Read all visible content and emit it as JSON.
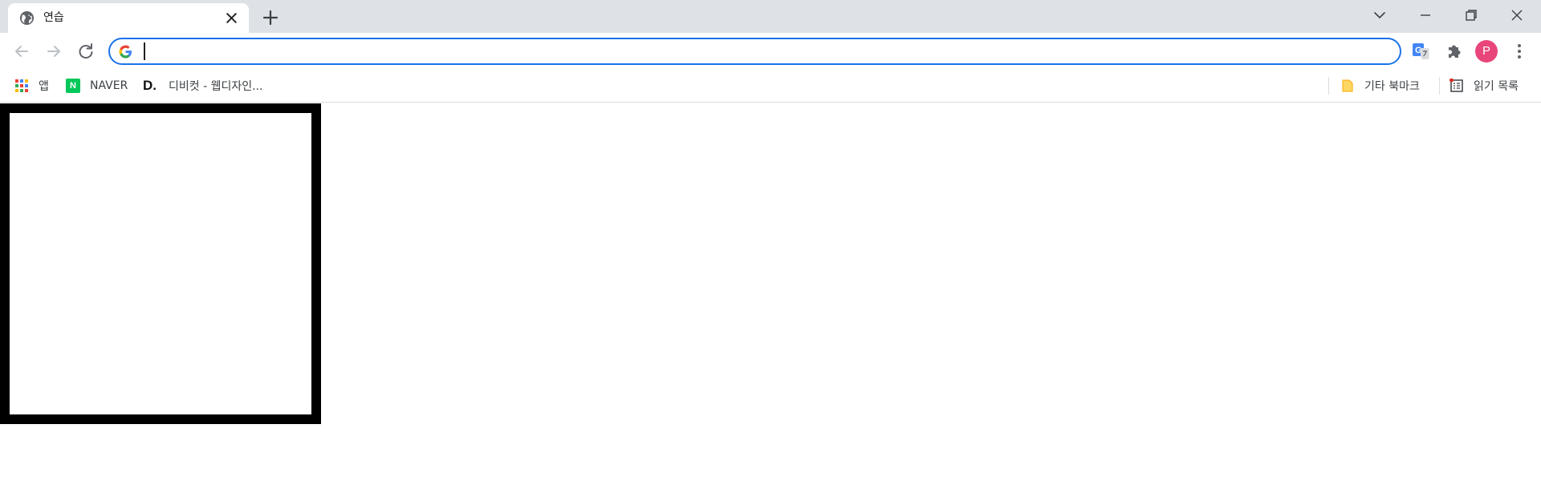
{
  "tab": {
    "title": "연습"
  },
  "toolbar": {
    "omnibox_value": "",
    "avatar_letter": "P"
  },
  "bookmarks": {
    "apps_label": "앱",
    "naver_label": "NAVER",
    "naver_icon_letter": "N",
    "dibicut_label": "디비컷 - 웹디자인...",
    "dibicut_icon_text": "D.",
    "other_bookmarks_label": "기타 북마크",
    "reading_list_label": "읽기 목록"
  },
  "colors": {
    "tabstrip": "#dee1e6",
    "omnibox_focus": "#1a73e8",
    "avatar": "#e8457a",
    "naver_green": "#03c75a",
    "box_border": "#000000"
  },
  "icons": {
    "favicon": "globe-icon",
    "close": "close-icon",
    "new_tab": "plus-icon",
    "back": "arrow-left-icon",
    "forward": "arrow-right-icon",
    "reload": "reload-icon",
    "translate": "translate-icon",
    "extensions": "puzzle-icon",
    "menu": "kebab-menu-icon",
    "folder": "folder-icon",
    "reading_list": "reading-list-icon"
  }
}
